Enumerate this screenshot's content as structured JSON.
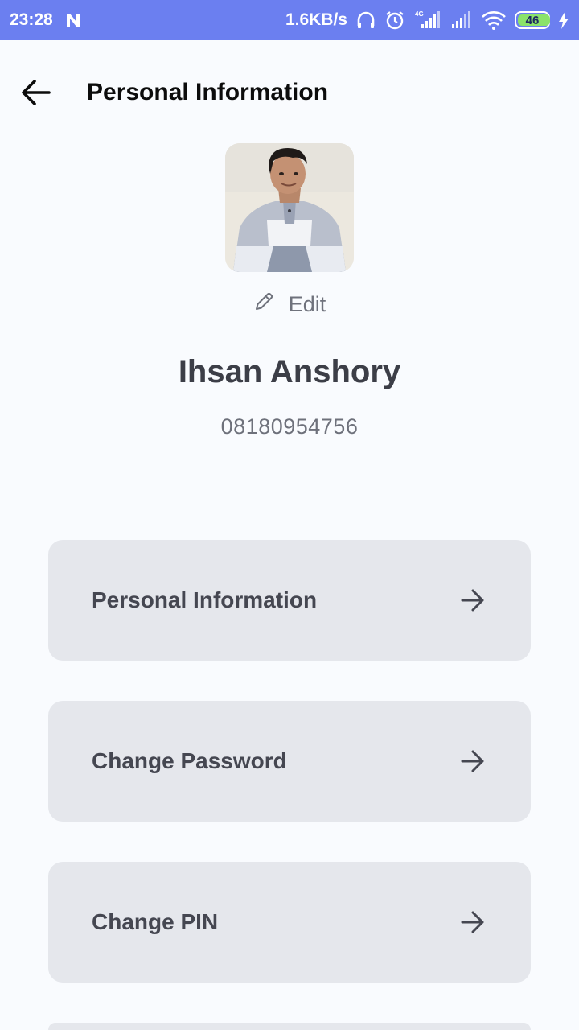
{
  "status_bar": {
    "time": "23:28",
    "network_speed": "1.6KB/s",
    "network_type": "4G",
    "battery_level": "46",
    "icons": [
      "n-notification-icon",
      "headphones-icon",
      "alarm-icon",
      "signal-4g-icon",
      "signal-icon",
      "wifi-icon",
      "battery-icon",
      "charging-bolt-icon"
    ]
  },
  "header": {
    "title": "Personal Information",
    "back_icon": "arrow-left-icon"
  },
  "profile": {
    "edit_label": "Edit",
    "edit_icon": "pencil-icon",
    "name": "Ihsan Anshory",
    "phone": "08180954756"
  },
  "menu": {
    "items": [
      {
        "label": "Personal Information",
        "icon": "arrow-right-icon"
      },
      {
        "label": "Change Password",
        "icon": "arrow-right-icon"
      },
      {
        "label": "Change PIN",
        "icon": "arrow-right-icon"
      }
    ]
  },
  "colors": {
    "status_bar": "#6b7ff0",
    "background": "#f9fbfe",
    "card": "#e5e7ec",
    "text_dark": "#3c3e47"
  }
}
